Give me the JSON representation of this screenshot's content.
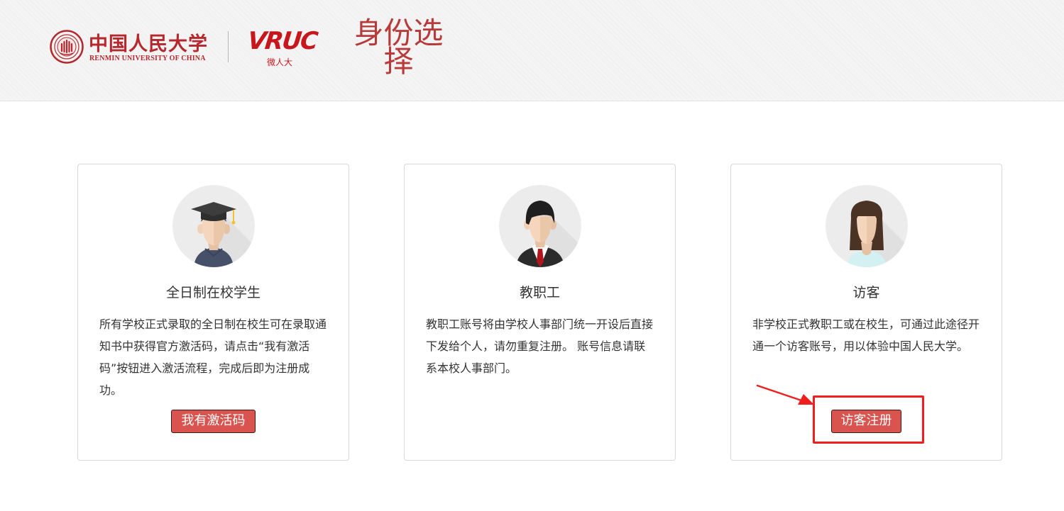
{
  "header": {
    "university_cn": "中国人民大学",
    "university_en": "RENMIN UNIVERSITY OF CHINA",
    "vruc_logo": "VRUC",
    "vruc_sub": "微人大",
    "page_title": "身份选择"
  },
  "cards": [
    {
      "title": "全日制在校学生",
      "description": "所有学校正式录取的全日制在校生可在录取通知书中获得官方激活码，请点击“我有激活码”按钮进入激活流程，完成后即为注册成功。",
      "button": "我有激活码",
      "avatar_icon": "student-graduate-icon"
    },
    {
      "title": "教职工",
      "description": "教职工账号将由学校人事部门统一开设后直接下发给个人，请勿重复注册。 账号信息请联系本校人事部门。",
      "avatar_icon": "staff-suit-icon"
    },
    {
      "title": "访客",
      "description": "非学校正式教职工或在校生，可通过此途径开通一个访客账号，用以体验中国人民大学。",
      "button": "访客注册",
      "avatar_icon": "visitor-woman-icon"
    }
  ],
  "annotation": {
    "highlight_color": "#f01e1e",
    "arrow_icon": "red-arrow-icon"
  },
  "colors": {
    "brand_red": "#b5282d",
    "button_red": "#d9534f",
    "title_red": "#b83a3a"
  }
}
